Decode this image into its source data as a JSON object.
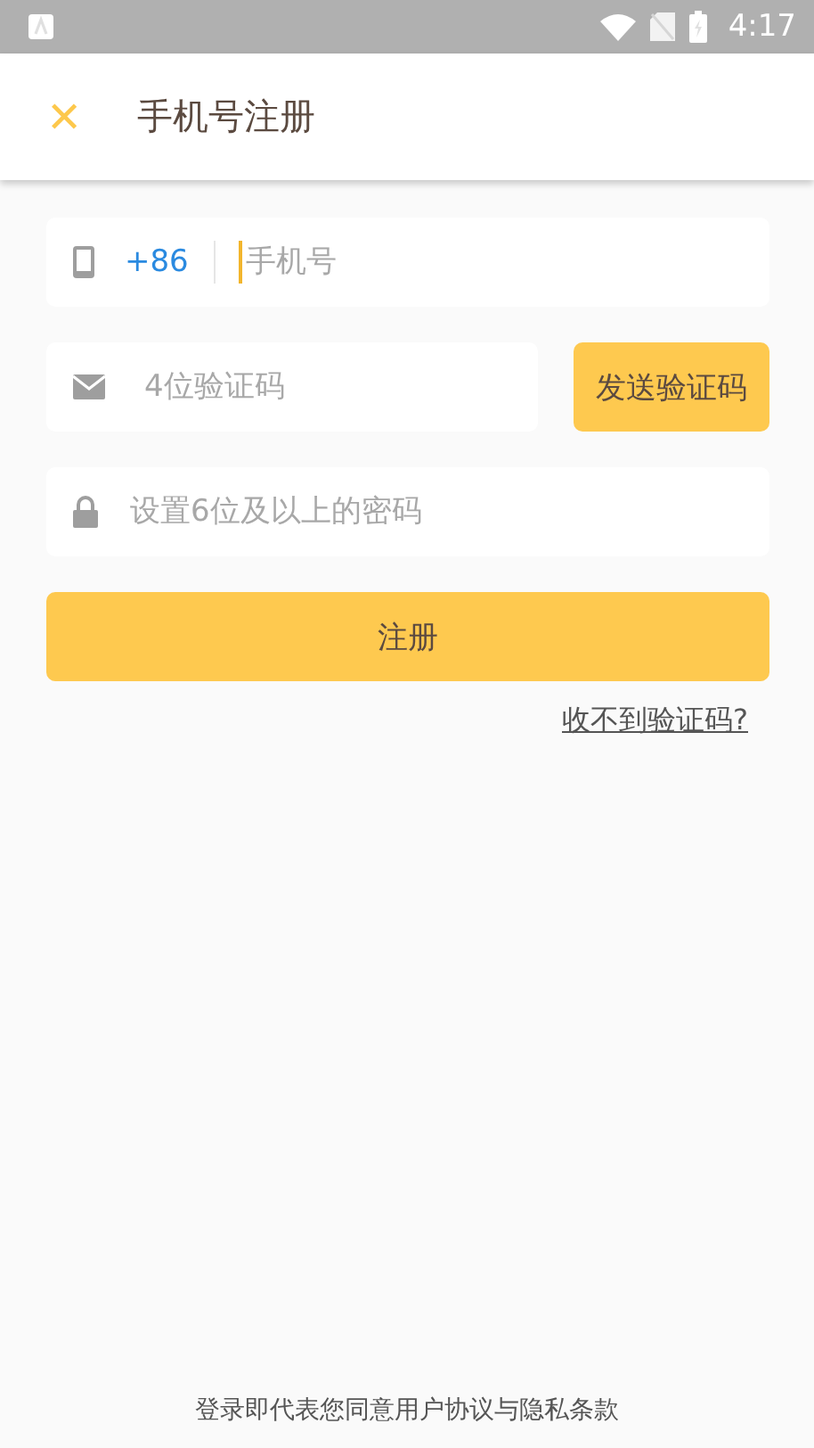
{
  "status_bar": {
    "time": "4:17"
  },
  "app_bar": {
    "close_icon": "✕",
    "title": "手机号注册"
  },
  "phone_field": {
    "country_code": "+86",
    "placeholder": "手机号"
  },
  "code_field": {
    "placeholder": "4位验证码"
  },
  "send_code_button": "发送验证码",
  "password_field": {
    "placeholder": "设置6位及以上的密码"
  },
  "register_button": "注册",
  "no_code_link": "收不到验证码?",
  "footer": "登录即代表您同意用户协议与隐私条款"
}
